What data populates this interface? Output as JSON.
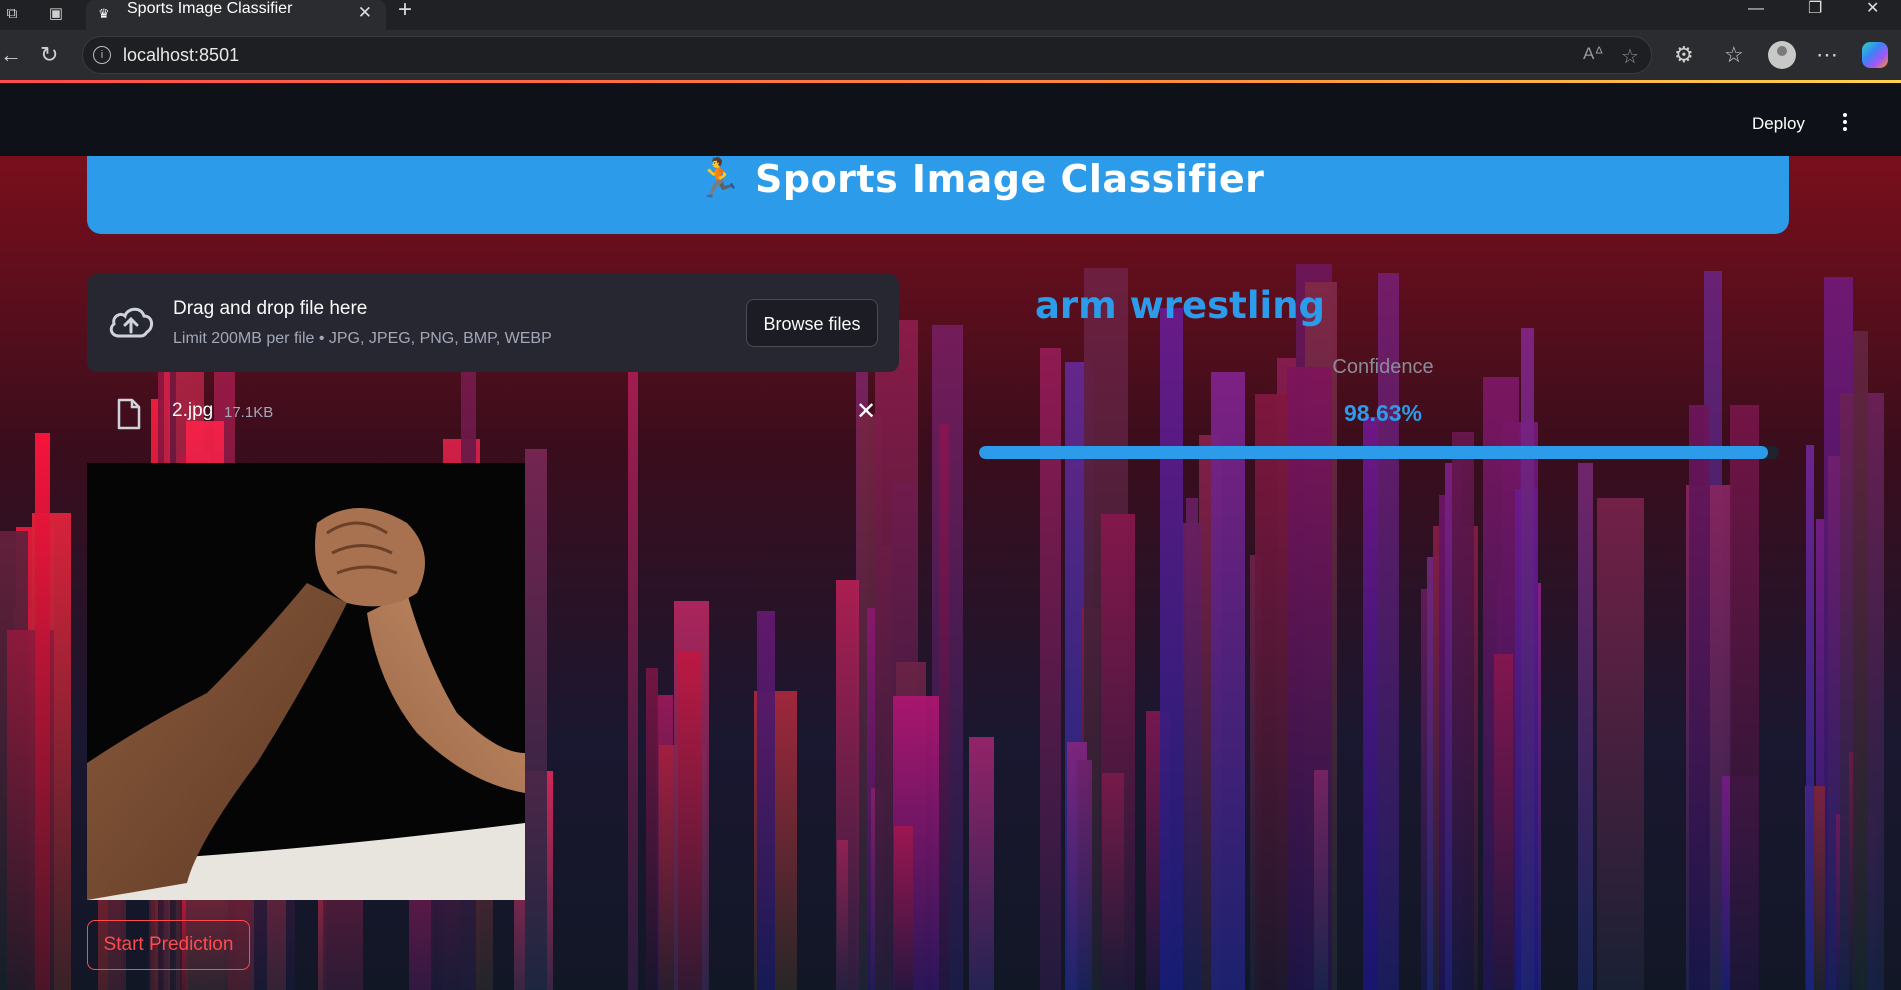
{
  "browser": {
    "tab_title": "Sports Image Classifier",
    "url": "localhost:8501"
  },
  "header": {
    "deploy_label": "Deploy"
  },
  "app": {
    "title": "Sports Image Classifier",
    "title_icon": "running-person-icon",
    "accent_color": "#2b9bea",
    "button_color": "#ff4b4b"
  },
  "uploader": {
    "drag_text": "Drag and drop file here",
    "limit_text": "Limit 200MB per file • JPG, JPEG, PNG, BMP, WEBP",
    "browse_label": "Browse files"
  },
  "file": {
    "name": "2.jpg",
    "size": "17.1KB"
  },
  "actions": {
    "start_label": "Start Prediction"
  },
  "result": {
    "label": "arm wrestling",
    "confidence_label": "Confidence",
    "confidence_value": "98.63%",
    "confidence_fraction": 0.9863
  }
}
